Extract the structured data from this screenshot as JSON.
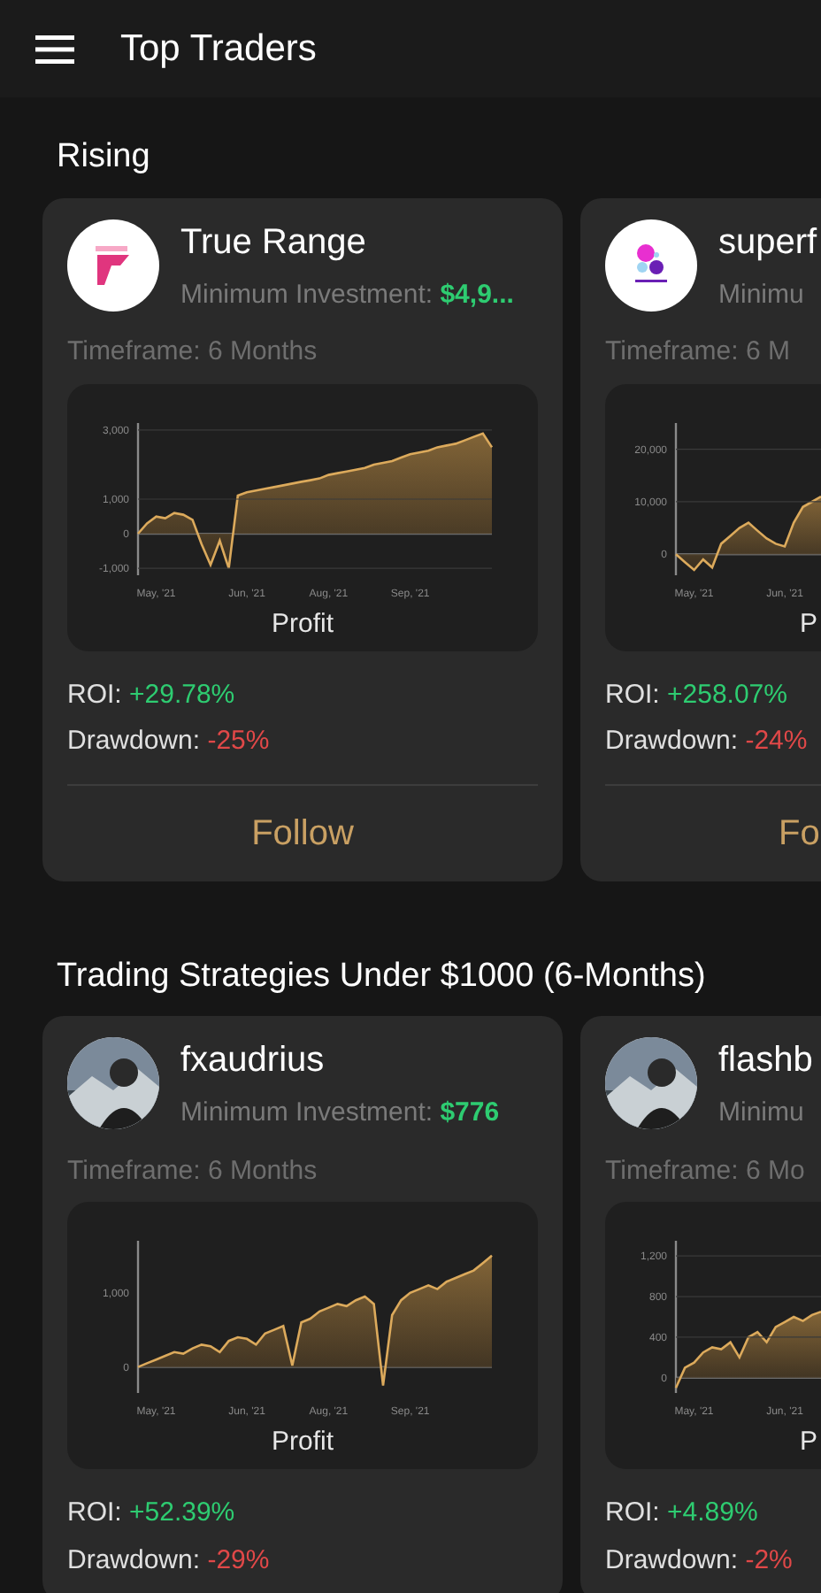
{
  "app_bar": {
    "title": "Top Traders"
  },
  "sections": [
    {
      "title": "Rising",
      "cards": [
        {
          "name": "True Range",
          "avatar": {
            "kind": "letter"
          },
          "min_label": "Minimum Investment: ",
          "min_value": "$4,9...",
          "timeframe": "Timeframe: 6 Months",
          "roi_label": "ROI: ",
          "roi": "+29.78%",
          "dd_label": "Drawdown: ",
          "drawdown": "-25%",
          "action": "Follow",
          "chart_data": {
            "type": "area",
            "title": "Profit",
            "grid": true,
            "ylim": [
              -1200,
              3200
            ],
            "yticks": [
              {
                "value": -1000,
                "label": "-1,000"
              },
              {
                "value": 0,
                "label": "0"
              },
              {
                "value": 1000,
                "label": "1,000"
              },
              {
                "value": 3000,
                "label": "3,000"
              }
            ],
            "categories": [
              null,
              null,
              "May, '21",
              null,
              null,
              null,
              null,
              null,
              null,
              null,
              null,
              null,
              "Jun, '21",
              null,
              null,
              null,
              null,
              null,
              null,
              null,
              null,
              "Aug, '21",
              null,
              null,
              null,
              null,
              null,
              null,
              null,
              null,
              "Sep, '21",
              null,
              null,
              null,
              null,
              null,
              null,
              null,
              null,
              null
            ],
            "values": [
              0,
              300,
              500,
              450,
              600,
              550,
              400,
              -300,
              -900,
              -200,
              -1000,
              1100,
              1200,
              1250,
              1300,
              1350,
              1400,
              1450,
              1500,
              1550,
              1600,
              1700,
              1750,
              1800,
              1850,
              1900,
              2000,
              2050,
              2100,
              2200,
              2300,
              2350,
              2400,
              2500,
              2550,
              2600,
              2700,
              2800,
              2900,
              2500
            ]
          }
        },
        {
          "name": "superf",
          "avatar": {
            "kind": "dots"
          },
          "min_label": "Minimu",
          "timeframe": "Timeframe: 6 M",
          "roi_label": "ROI: ",
          "roi": "+258.07%",
          "dd_label": "Drawdown: ",
          "drawdown": "-24%",
          "action": "Fo",
          "chart_data": {
            "type": "area",
            "title": "P",
            "grid": true,
            "ylim": [
              -4000,
              25000
            ],
            "yticks": [
              {
                "value": 0,
                "label": "0"
              },
              {
                "value": 10000,
                "label": "10,000"
              },
              {
                "value": 20000,
                "label": "20,000"
              }
            ],
            "categories": [
              null,
              null,
              "May, '21",
              null,
              null,
              null,
              null,
              null,
              null,
              null,
              null,
              null,
              "Jun, '21",
              null,
              null,
              null,
              null
            ],
            "values": [
              0,
              -1500,
              -3000,
              -1000,
              -2500,
              2000,
              3500,
              5000,
              6000,
              4500,
              3000,
              2000,
              1500,
              6000,
              9000,
              10000,
              11000
            ]
          }
        }
      ]
    },
    {
      "title": "Trading Strategies Under $1000 (6-Months)",
      "cards": [
        {
          "name": "fxaudrius",
          "min_label": "Minimum Investment: ",
          "min_value": "$776",
          "timeframe": "Timeframe: 6 Months",
          "roi_label": "ROI: ",
          "roi": "+52.39%",
          "dd_label": "Drawdown: ",
          "drawdown": "-29%",
          "chart_data": {
            "type": "area",
            "title": "Profit",
            "ylim": [
              -350,
              1700
            ],
            "yticks": [
              {
                "value": 0,
                "label": "0"
              },
              {
                "value": 1000,
                "label": "1,000"
              }
            ],
            "categories": [
              null,
              null,
              "May, '21",
              null,
              null,
              null,
              null,
              null,
              null,
              null,
              null,
              null,
              "Jun, '21",
              null,
              null,
              null,
              null,
              null,
              null,
              null,
              null,
              "Aug, '21",
              null,
              null,
              null,
              null,
              null,
              null,
              null,
              null,
              "Sep, '21",
              null,
              null,
              null,
              null,
              null,
              null,
              null,
              null,
              null
            ],
            "values": [
              0,
              50,
              100,
              150,
              200,
              180,
              250,
              300,
              280,
              200,
              350,
              400,
              380,
              300,
              450,
              500,
              550,
              20,
              600,
              650,
              750,
              800,
              850,
              820,
              900,
              950,
              850,
              -250,
              700,
              900,
              1000,
              1050,
              1100,
              1050,
              1150,
              1200,
              1250,
              1300,
              1400,
              1500
            ]
          }
        },
        {
          "name": "flashb",
          "min_label": "Minimu",
          "timeframe": "Timeframe: 6 Mo",
          "roi_label": "ROI: ",
          "roi": "+4.89%",
          "dd_label": "Drawdown: ",
          "drawdown": "-2%",
          "chart_data": {
            "type": "area",
            "title": "P",
            "grid": true,
            "ylim": [
              -150,
              1350
            ],
            "yticks": [
              {
                "value": 0,
                "label": "0"
              },
              {
                "value": 400,
                "label": "400"
              },
              {
                "value": 800,
                "label": "800"
              },
              {
                "value": 1200,
                "label": "1,200"
              }
            ],
            "categories": [
              null,
              null,
              "May, '21",
              null,
              null,
              null,
              null,
              null,
              null,
              null,
              null,
              null,
              "Jun, '21",
              null,
              null,
              null,
              null
            ],
            "values": [
              -100,
              100,
              150,
              250,
              300,
              280,
              350,
              200,
              400,
              450,
              350,
              500,
              550,
              600,
              560,
              620,
              650
            ]
          }
        }
      ]
    }
  ]
}
